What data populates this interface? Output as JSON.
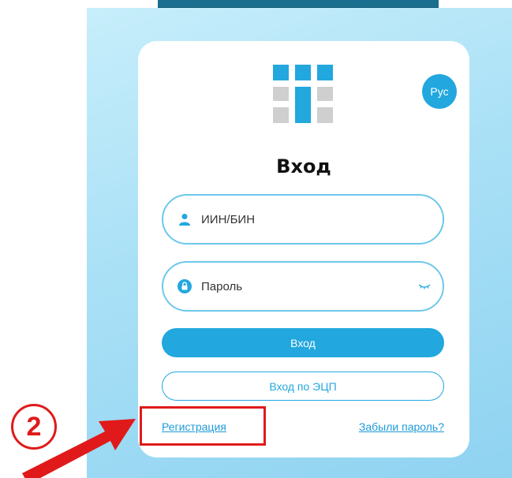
{
  "colors": {
    "accent": "#22a7df",
    "link": "#1e9bd7",
    "field_border": "#6cc8ea",
    "annotation_red": "#e01a1a",
    "logo_blue": "#22a7df",
    "logo_gray": "#cfcfcf"
  },
  "header": {
    "language_button": "Рус"
  },
  "login_form": {
    "title": "Вход",
    "login_field": {
      "placeholder": "ИИН/БИН",
      "value": "",
      "icon": "user-icon"
    },
    "password_field": {
      "placeholder": "Пароль",
      "value": "",
      "icon": "lock-icon",
      "toggle_icon": "eye-closed-icon"
    },
    "submit_button": "Вход",
    "eds_button": "Вход по ЭЦП",
    "register_link": "Регистрация",
    "forgot_link": "Забыли пароль?"
  },
  "annotation": {
    "step_number": "2",
    "target": "register-link"
  }
}
